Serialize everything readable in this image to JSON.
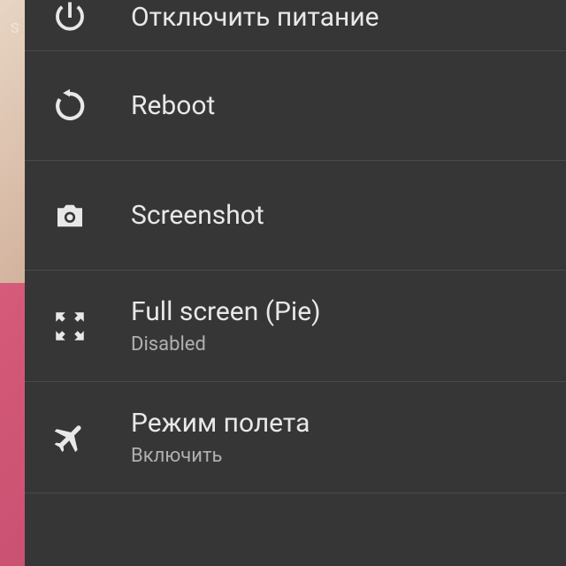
{
  "status_text": "S",
  "menu": {
    "items": [
      {
        "label": "Отключить питание",
        "sublabel": null,
        "icon": "power-icon"
      },
      {
        "label": "Reboot",
        "sublabel": null,
        "icon": "reboot-icon"
      },
      {
        "label": "Screenshot",
        "sublabel": null,
        "icon": "camera-icon"
      },
      {
        "label": "Full screen (Pie)",
        "sublabel": "Disabled",
        "icon": "fullscreen-icon"
      },
      {
        "label": "Режим полета",
        "sublabel": "Включить",
        "icon": "airplane-icon"
      }
    ]
  }
}
